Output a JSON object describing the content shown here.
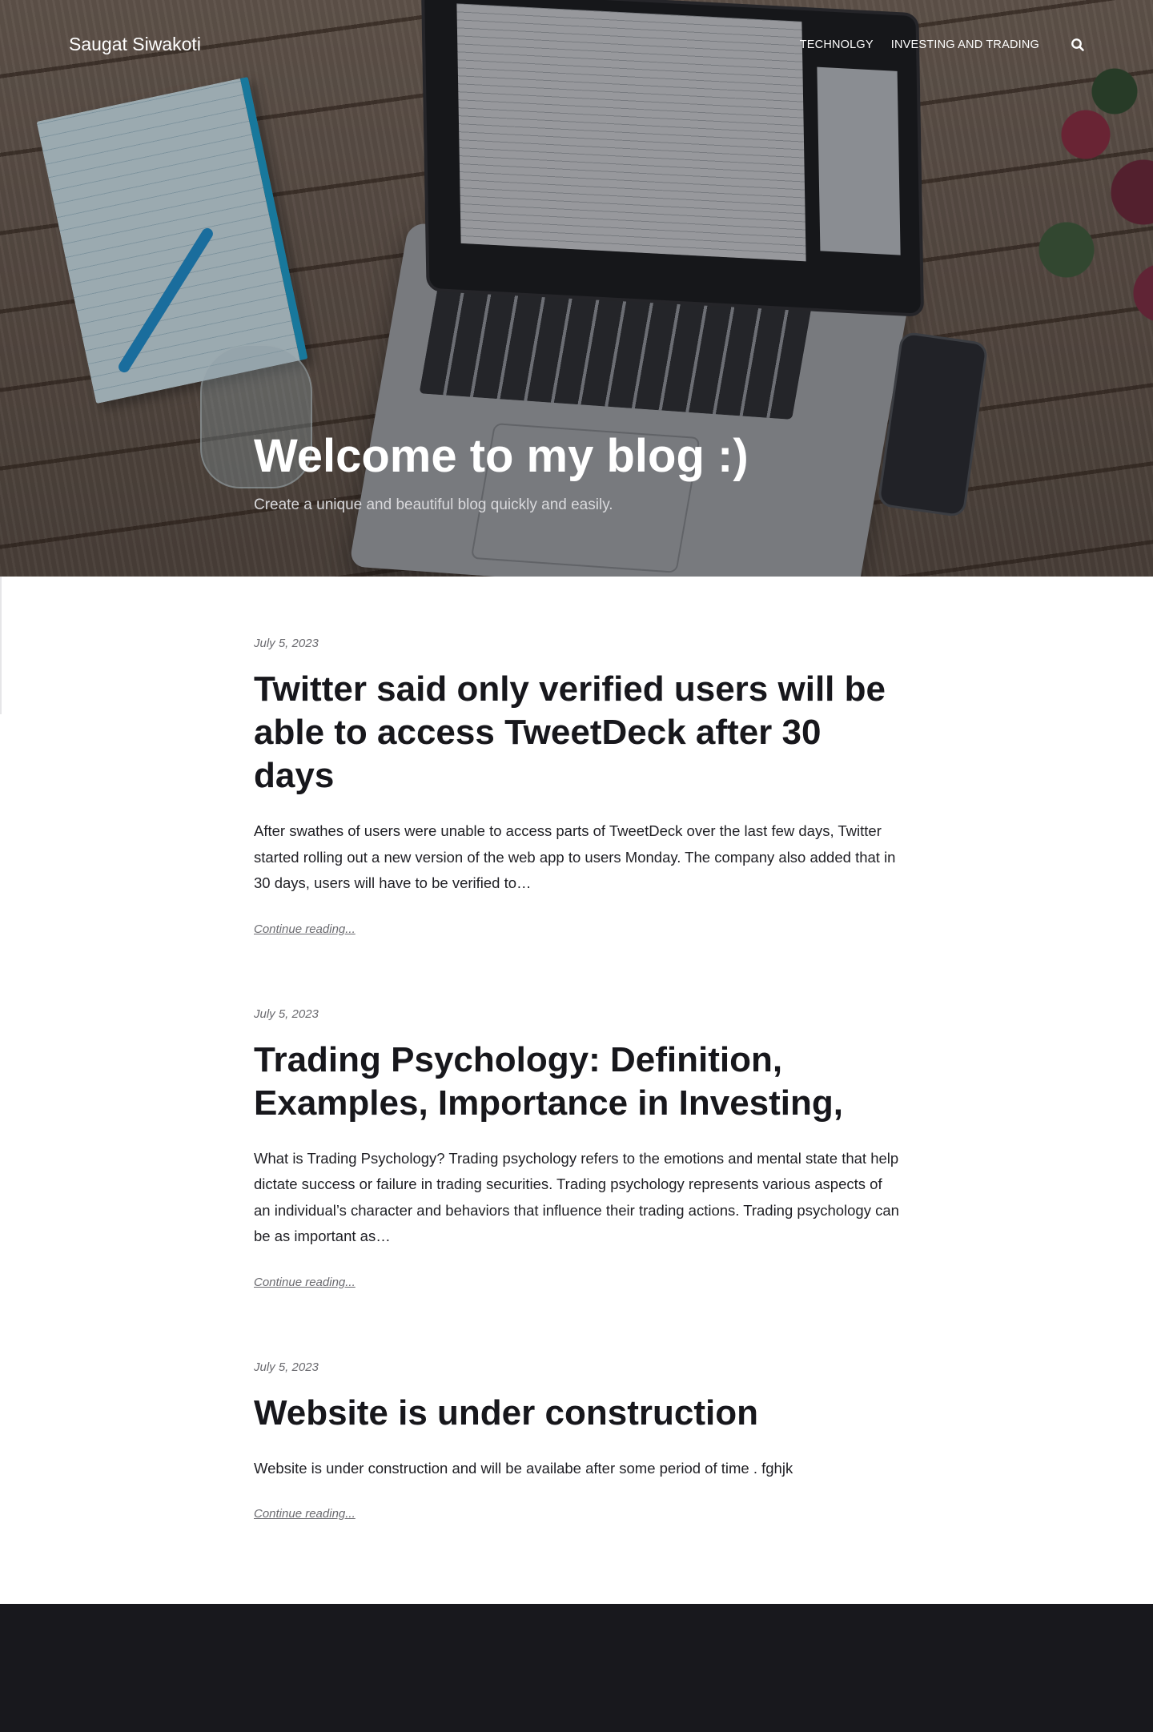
{
  "header": {
    "site_title": "Saugat Siwakoti",
    "nav": [
      {
        "label": "TECHNOLGY"
      },
      {
        "label": "INVESTING AND TRADING"
      }
    ],
    "search_icon": "search-icon"
  },
  "hero": {
    "title": "Welcome to my blog :)",
    "subtitle": "Create a unique and beautiful blog quickly and easily."
  },
  "posts": [
    {
      "date": "July 5, 2023",
      "title": "Twitter said only verified users will be able to access TweetDeck after 30 days",
      "excerpt": "After swathes of users were unable to access parts of TweetDeck over the last few days, Twitter started rolling out a new version of the web app to users Monday. The company also added that in 30 days, users will have to be verified to…",
      "link": "Continue reading..."
    },
    {
      "date": "July 5, 2023",
      "title": "Trading Psychology: Definition, Examples, Importance in Investing,",
      "excerpt": "What is Trading Psychology? Trading psychology refers to the emotions and mental state that help dictate success or failure in trading securities. Trading psychology represents various aspects of an individual’s character and behaviors that influence their trading actions. Trading psychology can be as important as…",
      "link": "Continue reading..."
    },
    {
      "date": "July 5, 2023",
      "title": "Website is under construction",
      "excerpt": "Website is under construction and will be availabe after some period of time . fghjk",
      "link": "Continue reading..."
    }
  ],
  "colors": {
    "footer_bg": "#18181d",
    "text_dark": "#17171c",
    "muted": "#6a6a6f"
  }
}
